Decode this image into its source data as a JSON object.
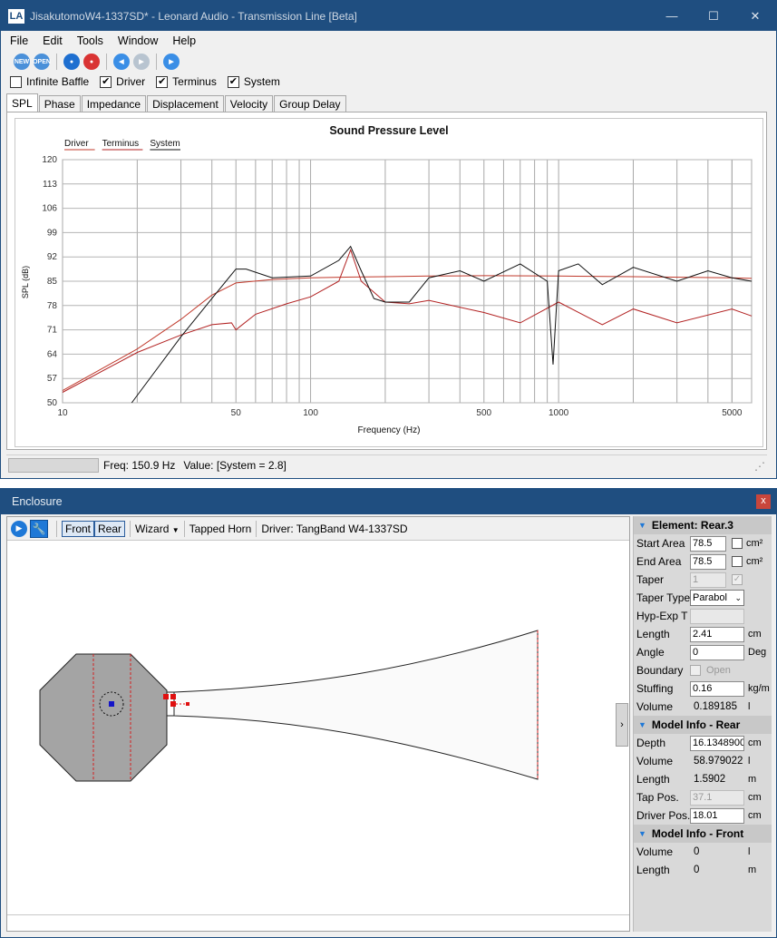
{
  "app": {
    "title": "JisakutomoW4-1337SD* - Leonard Audio - Transmission Line [Beta]",
    "logo": "LA",
    "min": "—",
    "max": "☐",
    "close": "✕"
  },
  "menu": [
    "File",
    "Edit",
    "Tools",
    "Window",
    "Help"
  ],
  "toolbar_icons": [
    "new-icon",
    "open-icon",
    "record-icon",
    "stop-icon",
    "prev-icon",
    "next-icon",
    "play-icon"
  ],
  "checks": {
    "infinite_baffle": "Infinite Baffle",
    "driver": "Driver",
    "terminus": "Terminus",
    "system": "System"
  },
  "tabs": [
    "SPL",
    "Phase",
    "Impedance",
    "Displacement",
    "Velocity",
    "Group Delay"
  ],
  "status": {
    "freq": "Freq: 150.9 Hz",
    "value": "Value: [System = 2.8]"
  },
  "chart_data": {
    "type": "line",
    "title": "Sound Pressure Level",
    "xlabel": "Frequency (Hz)",
    "ylabel": "SPL (dB)",
    "xscale": "log",
    "xlim": [
      10,
      6000
    ],
    "ylim": [
      50,
      120
    ],
    "xticks": [
      10,
      50,
      100,
      500,
      1000,
      5000
    ],
    "yticks": [
      50,
      57,
      64,
      71,
      78,
      85,
      92,
      99,
      106,
      113,
      120
    ],
    "grid": true,
    "legend": [
      "Driver",
      "Terminus",
      "System"
    ],
    "legend_placement": "top-left",
    "colors": {
      "Driver": "#c0392b",
      "Terminus": "#b22222",
      "System": "#111111"
    },
    "series": [
      {
        "name": "Driver",
        "x": [
          10,
          20,
          30,
          40,
          50,
          70,
          100,
          150,
          200,
          300,
          500,
          1000,
          2000,
          5000,
          6000
        ],
        "y": [
          53.5,
          65.5,
          74,
          81,
          84.5,
          85.5,
          86,
          86.2,
          86.3,
          86.5,
          86.6,
          86.5,
          86.3,
          86,
          85.8
        ]
      },
      {
        "name": "Terminus",
        "x": [
          10,
          20,
          30,
          40,
          48,
          50,
          52,
          60,
          80,
          100,
          130,
          145,
          160,
          200,
          250,
          300,
          400,
          500,
          700,
          1000,
          1500,
          2000,
          3000,
          5000,
          6000
        ],
        "y": [
          53,
          64.5,
          69.5,
          72.5,
          73,
          71,
          72,
          75.5,
          78.5,
          80.5,
          85,
          94,
          85,
          79,
          78.5,
          79.5,
          77.5,
          76,
          73,
          79,
          72.5,
          77,
          73,
          77,
          75
        ]
      },
      {
        "name": "System",
        "x": [
          19,
          30,
          40,
          50,
          55,
          70,
          100,
          130,
          145,
          160,
          180,
          200,
          250,
          300,
          400,
          500,
          700,
          900,
          950,
          1000,
          1200,
          1500,
          2000,
          3000,
          4000,
          5000,
          6000
        ],
        "y": [
          50,
          69,
          80,
          88.5,
          88.5,
          86,
          86.5,
          91,
          95,
          88,
          80,
          79,
          79,
          86,
          88,
          85,
          90,
          85,
          61,
          88,
          90,
          84,
          89,
          85,
          88,
          86,
          85
        ]
      }
    ]
  },
  "enclosure": {
    "title": "Enclosure",
    "close": "x",
    "front": "Front",
    "rear": "Rear",
    "wizard": "Wizard",
    "tapped_horn": "Tapped Horn",
    "driver": "Driver: TangBand W4-1337SD",
    "play_icon": "play-icon",
    "wrench_icon": "wrench-icon"
  },
  "element": {
    "header": "Element: Rear.3",
    "start_area_label": "Start Area",
    "start_area": "78.5",
    "start_unit": "cm²",
    "end_area_label": "End Area",
    "end_area": "78.5",
    "end_unit": "cm²",
    "taper_label": "Taper",
    "taper": "1",
    "taper_type_label": "Taper Type",
    "taper_type": "Parabol",
    "hyp_label": "Hyp-Exp T",
    "length_label": "Length",
    "length": "2.41",
    "length_unit": "cm",
    "angle_label": "Angle",
    "angle": "0",
    "angle_unit": "Deg",
    "boundary_label": "Boundary",
    "boundary_open": "Open",
    "stuffing_label": "Stuffing",
    "stuffing": "0.16",
    "stuffing_unit": "kg/m",
    "volume_label": "Volume",
    "volume": "0.189185",
    "volume_unit": "l"
  },
  "model_rear": {
    "header": "Model Info - Rear",
    "depth_label": "Depth",
    "depth": "16.1348900",
    "depth_unit": "cm",
    "volume_label": "Volume",
    "volume": "58.979022",
    "volume_unit": "l",
    "length_label": "Length",
    "length": "1.5902",
    "length_unit": "m",
    "tap_label": "Tap Pos.",
    "tap": "37.1",
    "tap_unit": "cm",
    "driver_pos_label": "Driver Pos.",
    "driver_pos": "18.01",
    "driver_pos_unit": "cm"
  },
  "model_front": {
    "header": "Model Info - Front",
    "volume_label": "Volume",
    "volume": "0",
    "volume_unit": "l",
    "length_label": "Length",
    "length": "0",
    "length_unit": "m"
  }
}
